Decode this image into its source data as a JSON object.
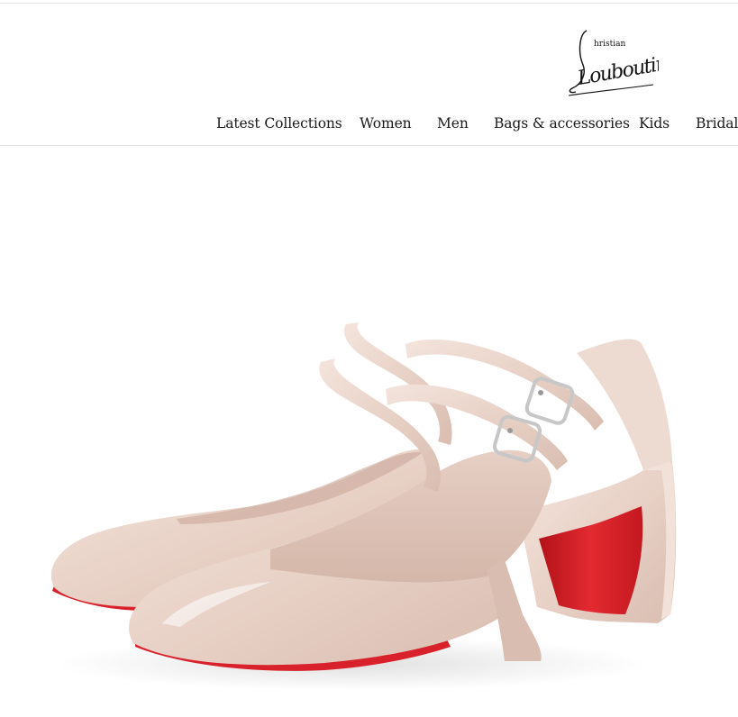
{
  "brand": {
    "name": "Christian Louboutin",
    "logo_top": "hristian",
    "logo_script": "Louboutin"
  },
  "nav": {
    "items": [
      {
        "label": "Latest Collections"
      },
      {
        "label": "Women"
      },
      {
        "label": "Men"
      },
      {
        "label": "Bags & accessories"
      },
      {
        "label": "Kids"
      },
      {
        "label": "Bridal"
      }
    ]
  },
  "product": {
    "image": "nude patent Mary Jane pumps with double ankle straps, silver buckles and red lacquered soles",
    "colors": {
      "upper": "#ead4c9",
      "sole": "#d8212a",
      "buckle": "#c7c7c7"
    }
  }
}
